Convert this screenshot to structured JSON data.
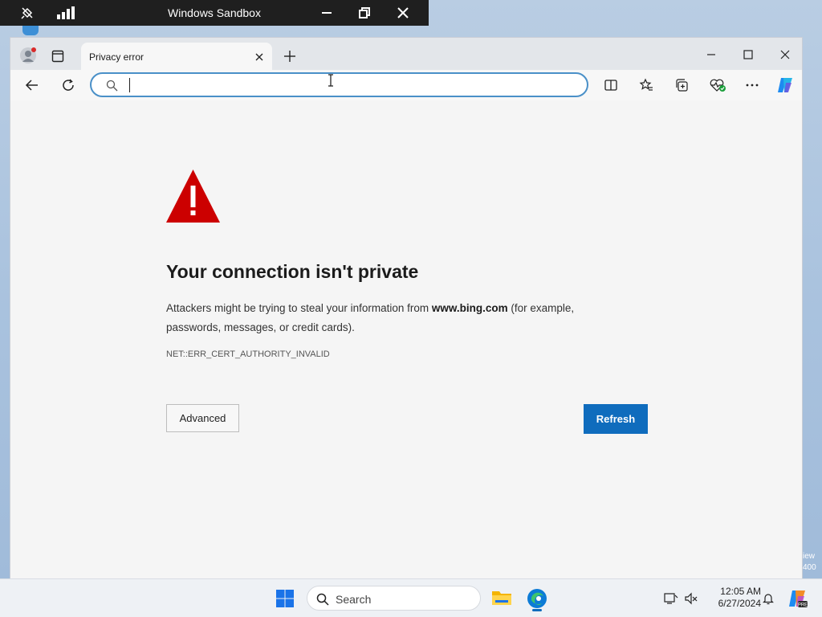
{
  "sandbox": {
    "title": "Windows Sandbox"
  },
  "browser": {
    "tab": {
      "title": "Privacy error"
    },
    "address": {
      "value": "",
      "placeholder": ""
    }
  },
  "page": {
    "heading": "Your connection isn't private",
    "para_before": "Attackers might be trying to steal your information from ",
    "para_domain": "www.bing.com",
    "para_after": " (for example, passwords, messages, or credit cards).",
    "error_code": "NET::ERR_CERT_AUTHORITY_INVALID",
    "advanced_label": "Advanced",
    "refresh_label": "Refresh"
  },
  "taskbar": {
    "search_label": "Search",
    "time": "12:05 AM",
    "date": "6/27/2024"
  },
  "desktop": {
    "edge_text_1": "iew",
    "edge_text_2": "400"
  },
  "colors": {
    "accent": "#0f6cbd",
    "warning": "#cc0000",
    "sandbox_bar": "#1f1f1f"
  }
}
